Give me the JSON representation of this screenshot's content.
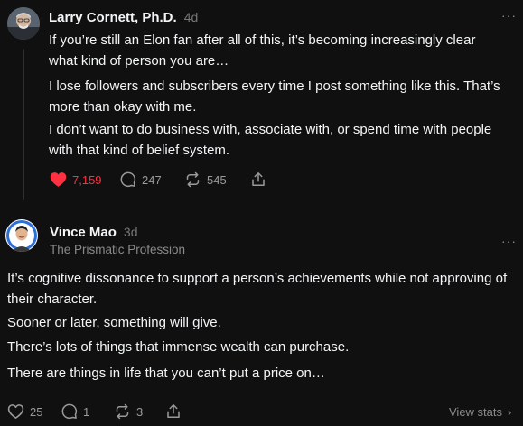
{
  "posts": [
    {
      "author": "Larry Cornett, Ph.D.",
      "time": "4d",
      "more": "···",
      "paragraphs": [
        "If you’re still an Elon fan after all of this, it’s becoming increasingly clear what kind of person you are…",
        "I lose followers and subscribers every time I post something like this. That’s more than okay with me.",
        "I don’t want to do business with, associate with, or spend time with people with that kind of belief system."
      ],
      "likes": "7,159",
      "comments": "247",
      "reposts": "545",
      "liked": true,
      "accent_color": "#ff3040"
    },
    {
      "author": "Vince Mao",
      "time": "3d",
      "subtitle": "The Prismatic Profession",
      "more": "···",
      "paragraphs": [
        "It’s cognitive dissonance to support a person’s achievements while not approving of their character.",
        "Sooner or later, something will give.",
        "There’s lots of things that immense wealth can purchase.",
        "There are things in life that you can’t put a price on…"
      ],
      "likes": "25",
      "comments": "1",
      "reposts": "3",
      "view_stats": "View stats",
      "chevron": "›"
    }
  ]
}
